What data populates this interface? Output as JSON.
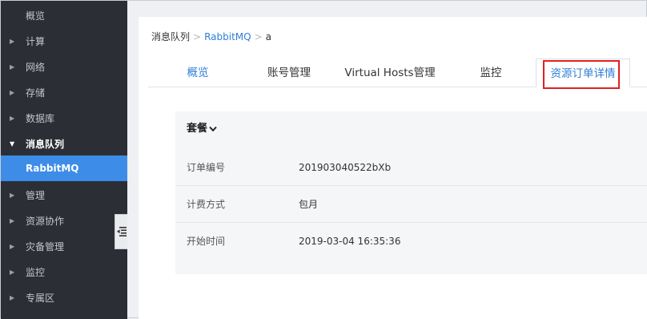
{
  "sidebar": {
    "items": [
      {
        "label": "概览"
      },
      {
        "label": "计算"
      },
      {
        "label": "网络"
      },
      {
        "label": "存储"
      },
      {
        "label": "数据库"
      },
      {
        "label": "消息队列"
      },
      {
        "label": "RabbitMQ"
      },
      {
        "label": "管理"
      },
      {
        "label": "资源协作"
      },
      {
        "label": "灾备管理"
      },
      {
        "label": "监控"
      },
      {
        "label": "专属区"
      }
    ]
  },
  "breadcrumb": {
    "root": "消息队列",
    "sep": ">",
    "service": "RabbitMQ",
    "instance": "a"
  },
  "tabs": [
    {
      "label": "概览"
    },
    {
      "label": "账号管理"
    },
    {
      "label": "Virtual Hosts管理"
    },
    {
      "label": "监控"
    },
    {
      "label": "资源订单详情"
    }
  ],
  "panel": {
    "title": "套餐",
    "rows": [
      {
        "key": "订单编号",
        "value": "201903040522bXb"
      },
      {
        "key": "计费方式",
        "value": "包月"
      },
      {
        "key": "开始时间",
        "value": "2019-03-04 16:35:36"
      }
    ]
  },
  "colors": {
    "accent": "#2f7ed8",
    "sidebar_bg": "#2b2f35",
    "active_item": "#3d8de8",
    "highlight_box": "#e02020"
  }
}
